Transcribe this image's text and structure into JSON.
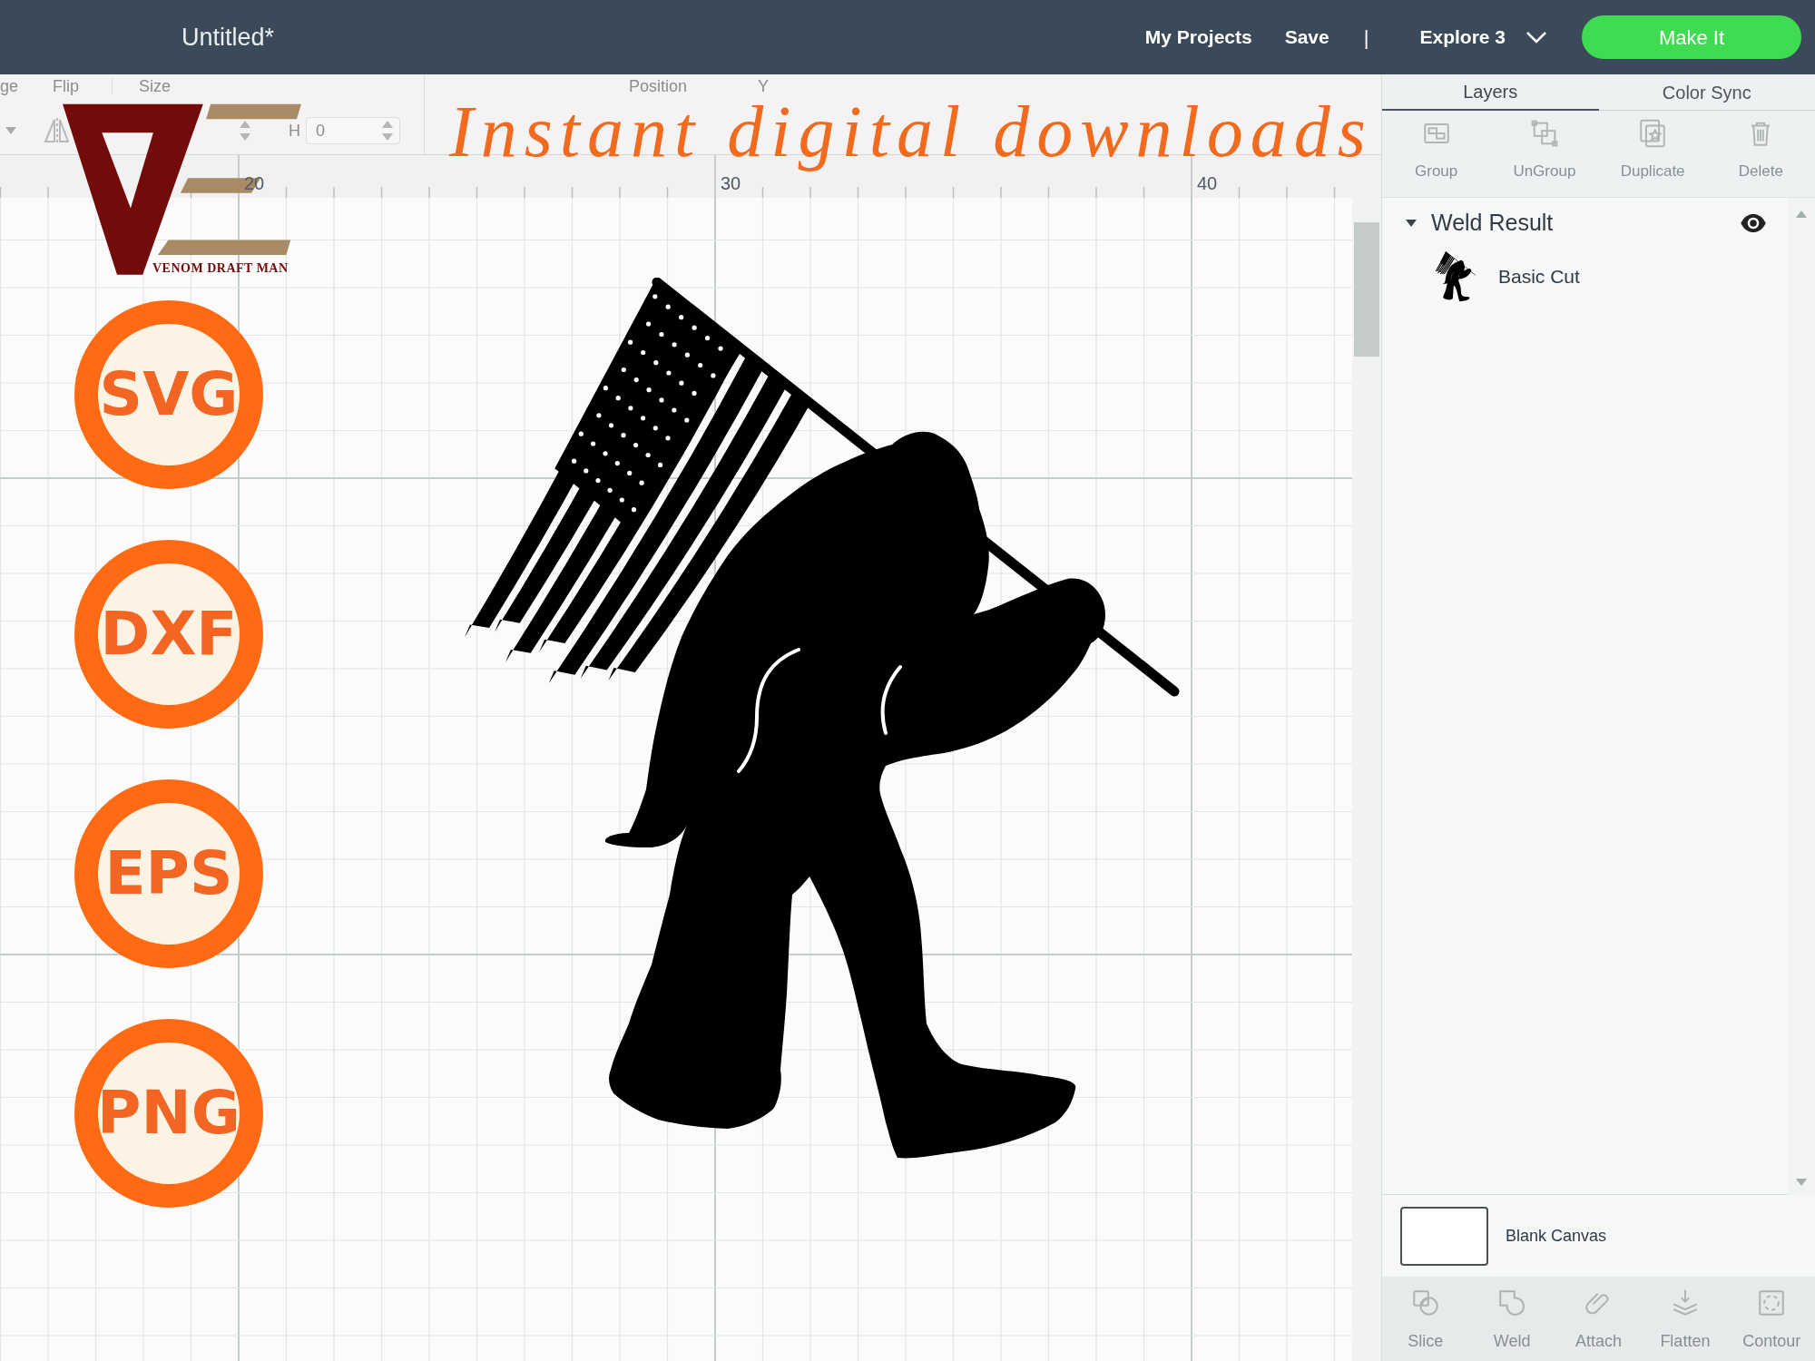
{
  "top_bar": {
    "title": "Untitled*",
    "links": [
      "My Projects",
      "Save"
    ],
    "separator": "|",
    "machine": "Explore 3",
    "primary_button": "Make It"
  },
  "toolbar": [
    {
      "label": "ge",
      "controls": [
        {
          "kind": "dropdown"
        }
      ]
    },
    {
      "label": "Flip",
      "controls": [
        {
          "kind": "flip"
        }
      ]
    },
    {
      "label": "Size",
      "controls": [
        {
          "kind": "stepper"
        },
        {
          "kind": "label",
          "text": "H"
        },
        {
          "kind": "field",
          "value": "0"
        }
      ]
    },
    {
      "label": "Position",
      "controls": [
        {
          "kind": "label",
          "text": "Y"
        }
      ]
    }
  ],
  "ruler": {
    "labels": [
      "20",
      "30",
      "40"
    ]
  },
  "promo": {
    "headline": "Instant digital downloads",
    "brand": "VENOM DRAFT MAN",
    "formats": [
      "SVG",
      "DXF",
      "EPS",
      "PNG"
    ]
  },
  "layers_panel": {
    "tabs": [
      {
        "label": "Layers",
        "selected": true
      },
      {
        "label": "Color Sync",
        "selected": false
      }
    ],
    "tools": [
      {
        "kind": "group",
        "label": "Group",
        "disabled": true
      },
      {
        "kind": "ungroup",
        "label": "UnGroup",
        "disabled": true
      },
      {
        "kind": "duplicate",
        "label": "Duplicate",
        "disabled": true
      },
      {
        "kind": "delete",
        "label": "Delete",
        "disabled": true
      }
    ],
    "layers": [
      {
        "label": "Weld Result",
        "expanded": true,
        "children": [
          {
            "label": "Basic Cut"
          }
        ]
      }
    ],
    "canvas_layer": {
      "label": "Blank Canvas"
    },
    "bottom_tools": [
      {
        "kind": "slice",
        "label": "Slice",
        "disabled": true
      },
      {
        "kind": "weld",
        "label": "Weld",
        "disabled": true
      },
      {
        "kind": "attach",
        "label": "Attach",
        "disabled": true
      },
      {
        "kind": "flatten",
        "label": "Flatten",
        "disabled": true
      },
      {
        "kind": "contour",
        "label": "Contour",
        "disabled": true
      }
    ]
  }
}
